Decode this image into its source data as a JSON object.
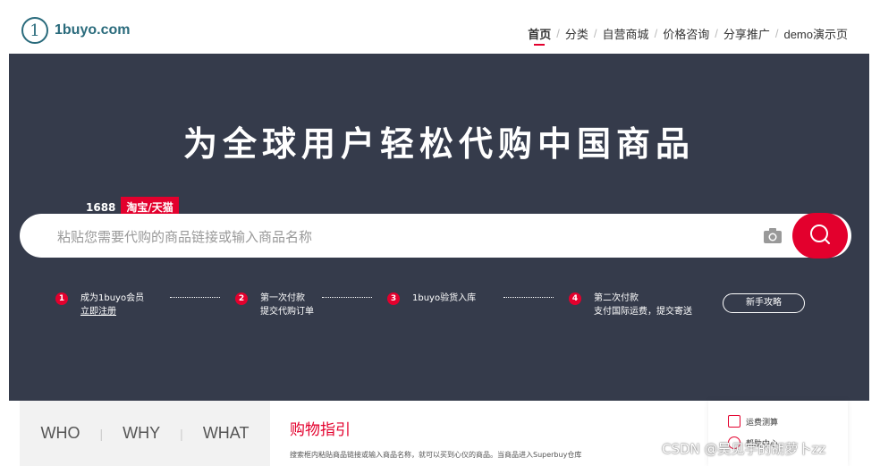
{
  "header": {
    "logo_mark": "1",
    "logo_text": "1buyo.com",
    "nav": [
      {
        "label": "首页",
        "active": true
      },
      {
        "label": "分类",
        "active": false
      },
      {
        "label": "自营商城",
        "active": false
      },
      {
        "label": "价格咨询",
        "active": false
      },
      {
        "label": "分享推广",
        "active": false
      },
      {
        "label": "demo演示页",
        "active": false
      }
    ],
    "nav_separator": "/"
  },
  "hero": {
    "title": "为全球用户轻松代购中国商品",
    "tabs": [
      {
        "label": "1688",
        "active": false
      },
      {
        "label": "淘宝/天猫",
        "active": true
      }
    ],
    "search": {
      "placeholder": "粘贴您需要代购的商品链接或输入商品名称",
      "value": ""
    },
    "icons": {
      "camera": "camera-icon",
      "search": "search-icon"
    }
  },
  "steps": [
    {
      "num": "1",
      "line1": "成为1buyo会员",
      "line2": "立即注册",
      "line2_link": true
    },
    {
      "num": "2",
      "line1": "第一次付款",
      "line2": "提交代购订单",
      "line2_link": false
    },
    {
      "num": "3",
      "line1": "1buyo验货入库",
      "line2": "",
      "line2_link": false
    },
    {
      "num": "4",
      "line1": "第二次付款",
      "line2": "支付国际运费，提交寄送",
      "line2_link": false
    }
  ],
  "guide_button": "新手攻略",
  "lower": {
    "who": "WHO",
    "why": "WHY",
    "what": "WHAT",
    "guide_title": "购物指引",
    "guide_desc": "搜索框内粘贴商品链接或输入商品名称，就可以买到心仪的商品。当商品进入Superbuy仓库",
    "sidebar": [
      {
        "label": "运费测算",
        "icon": "shipping-calc-icon"
      },
      {
        "label": "帮助中心",
        "icon": "help-center-icon"
      }
    ]
  },
  "watermark": "CSDN @吴见宇的胡萝卜zz",
  "colors": {
    "accent": "#e3002d",
    "hero_bg": "#353b4b",
    "logo": "#2a6b7c"
  }
}
